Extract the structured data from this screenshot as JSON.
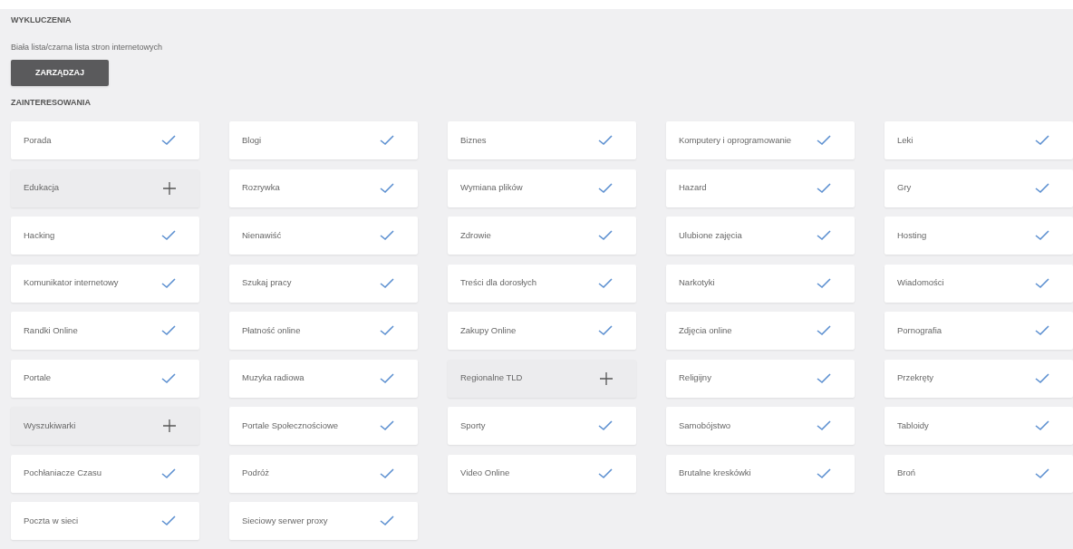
{
  "exclusions": {
    "title": "WYKLUCZENIA",
    "description": "Biała lista/czarna lista stron internetowych",
    "button": "ZARZĄDZAJ"
  },
  "interests": {
    "title": "ZAINTERESOWANIA",
    "items": [
      {
        "label": "Porada",
        "selected": true
      },
      {
        "label": "Blogi",
        "selected": true
      },
      {
        "label": "Biznes",
        "selected": true
      },
      {
        "label": "Komputery i oprogramowanie",
        "selected": true
      },
      {
        "label": "Leki",
        "selected": true
      },
      {
        "label": "Edukacja",
        "selected": false
      },
      {
        "label": "Rozrywka",
        "selected": true
      },
      {
        "label": "Wymiana plików",
        "selected": true
      },
      {
        "label": "Hazard",
        "selected": true
      },
      {
        "label": "Gry",
        "selected": true
      },
      {
        "label": "Hacking",
        "selected": true
      },
      {
        "label": "Nienawiść",
        "selected": true
      },
      {
        "label": "Zdrowie",
        "selected": true
      },
      {
        "label": "Ulubione zajęcia",
        "selected": true
      },
      {
        "label": "Hosting",
        "selected": true
      },
      {
        "label": "Komunikator internetowy",
        "selected": true
      },
      {
        "label": "Szukaj pracy",
        "selected": true
      },
      {
        "label": "Treści dla dorosłych",
        "selected": true
      },
      {
        "label": "Narkotyki",
        "selected": true
      },
      {
        "label": "Wiadomości",
        "selected": true
      },
      {
        "label": "Randki Online",
        "selected": true
      },
      {
        "label": "Płatność online",
        "selected": true
      },
      {
        "label": "Zakupy Online",
        "selected": true
      },
      {
        "label": "Zdjęcia online",
        "selected": true
      },
      {
        "label": "Pornografia",
        "selected": true
      },
      {
        "label": "Portale",
        "selected": true
      },
      {
        "label": "Muzyka radiowa",
        "selected": true
      },
      {
        "label": "Regionalne TLD",
        "selected": false
      },
      {
        "label": "Religijny",
        "selected": true
      },
      {
        "label": "Przekręty",
        "selected": true
      },
      {
        "label": "Wyszukiwarki",
        "selected": false
      },
      {
        "label": "Portale Społecznościowe",
        "selected": true
      },
      {
        "label": "Sporty",
        "selected": true
      },
      {
        "label": "Samobójstwo",
        "selected": true
      },
      {
        "label": "Tabloidy",
        "selected": true
      },
      {
        "label": "Pochłaniacze Czasu",
        "selected": true
      },
      {
        "label": "Podróż",
        "selected": true
      },
      {
        "label": "Video Online",
        "selected": true
      },
      {
        "label": "Brutalne kreskówki",
        "selected": true
      },
      {
        "label": "Broń",
        "selected": true
      },
      {
        "label": "Poczta w sieci",
        "selected": true
      },
      {
        "label": "Sieciowy serwer proxy",
        "selected": true
      }
    ]
  }
}
